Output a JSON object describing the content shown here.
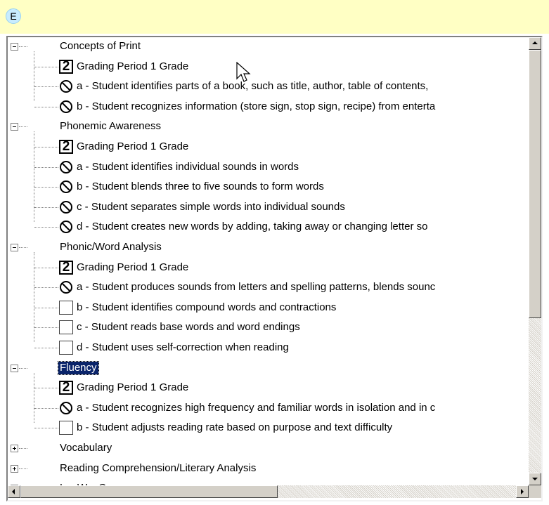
{
  "header": {
    "badge": "E"
  },
  "tree": {
    "categories": [
      {
        "label": "Concepts of Print",
        "expanded": true,
        "selected": false,
        "items": [
          {
            "icon": "grade-2-icon",
            "label": "Grading Period 1 Grade",
            "grade": "2"
          },
          {
            "icon": "not-allowed-icon",
            "label": "a - Student identifies parts of a book, such as title, author, table of contents, "
          },
          {
            "icon": "not-allowed-icon",
            "label": "b - Student recognizes information (store sign, stop sign, recipe) from enterta"
          }
        ]
      },
      {
        "label": "Phonemic Awareness",
        "expanded": true,
        "selected": false,
        "items": [
          {
            "icon": "grade-2-icon",
            "label": "Grading Period 1 Grade",
            "grade": "2"
          },
          {
            "icon": "not-allowed-icon",
            "label": "a - Student identifies individual sounds in words"
          },
          {
            "icon": "not-allowed-icon",
            "label": "b - Student blends three to five sounds to form words"
          },
          {
            "icon": "not-allowed-icon",
            "label": "c - Student separates simple words into individual sounds"
          },
          {
            "icon": "not-allowed-icon",
            "label": "d - Student creates new words by adding, taking away or changing letter so"
          }
        ]
      },
      {
        "label": "Phonic/Word Analysis",
        "expanded": true,
        "selected": false,
        "items": [
          {
            "icon": "grade-2-icon",
            "label": "Grading Period 1 Grade",
            "grade": "2"
          },
          {
            "icon": "not-allowed-icon",
            "label": "a - Student produces sounds from letters and spelling patterns, blends sounc"
          },
          {
            "icon": "empty-box-icon",
            "label": "b - Student identifies compound words and contractions"
          },
          {
            "icon": "empty-box-icon",
            "label": "c - Student reads base words and word endings"
          },
          {
            "icon": "empty-box-icon",
            "label": "d - Student uses self-correction when reading"
          }
        ]
      },
      {
        "label": "Fluency",
        "expanded": true,
        "selected": true,
        "items": [
          {
            "icon": "grade-2-icon",
            "label": "Grading Period 1 Grade",
            "grade": "2"
          },
          {
            "icon": "not-allowed-icon",
            "label": "a - Student recognizes high frequency and familiar words in isolation and in c"
          },
          {
            "icon": "empty-box-icon",
            "label": "b - Student adjusts reading rate based on purpose and text difficulty"
          }
        ]
      },
      {
        "label": "Vocabulary",
        "expanded": false,
        "selected": false,
        "items": []
      },
      {
        "label": "Reading Comprehension/Literary Analysis",
        "expanded": false,
        "selected": false,
        "items": []
      },
      {
        "label": "L... W... C...",
        "expanded": false,
        "selected": false,
        "items": []
      }
    ]
  },
  "colors": {
    "header_bg": "#ffffc4",
    "selection_bg": "#0a246a",
    "scrollbar": "#d4d0c8"
  }
}
